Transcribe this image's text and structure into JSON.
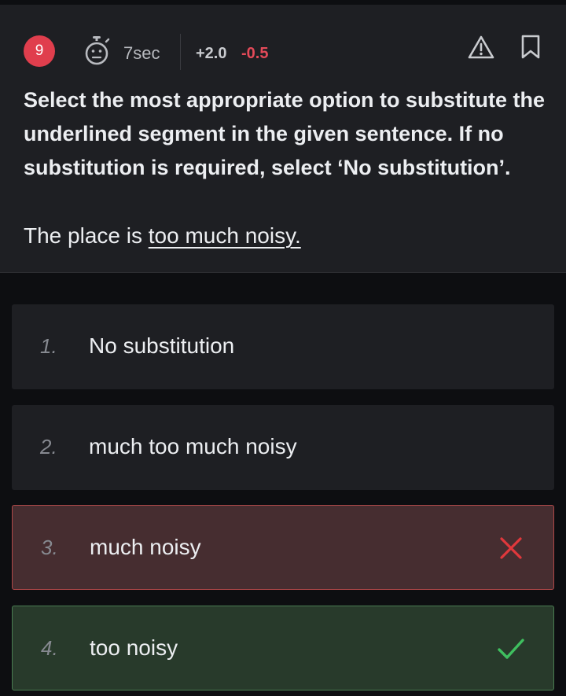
{
  "question": {
    "number": "9",
    "timer": "7sec",
    "positive_marks": "+2.0",
    "negative_marks": "-0.5",
    "prompt": "Select the most appropriate option to substitute the underlined segment in the given sentence. If no substitution is required, select ‘No substitution’.",
    "sentence_prefix": "The place is ",
    "sentence_underlined": "too much noisy."
  },
  "options": [
    {
      "number": "1.",
      "label": "No substitution",
      "state": "neutral"
    },
    {
      "number": "2.",
      "label": "much too much noisy",
      "state": "neutral"
    },
    {
      "number": "3.",
      "label": "much noisy",
      "state": "wrong"
    },
    {
      "number": "4.",
      "label": "too noisy",
      "state": "correct"
    }
  ],
  "icons": {
    "timer": "face-stopwatch-icon",
    "report": "warning-triangle-icon",
    "bookmark": "bookmark-icon",
    "wrong": "cross-icon",
    "correct": "check-icon"
  },
  "colors": {
    "badge": "#e03e4d",
    "negative": "#e34a59",
    "wrong_bg": "#462d30",
    "wrong_border": "#b04848",
    "wrong_mark": "#e0383c",
    "correct_bg": "#283a2b",
    "correct_border": "#4a7d52",
    "correct_mark": "#3fbf5f"
  }
}
